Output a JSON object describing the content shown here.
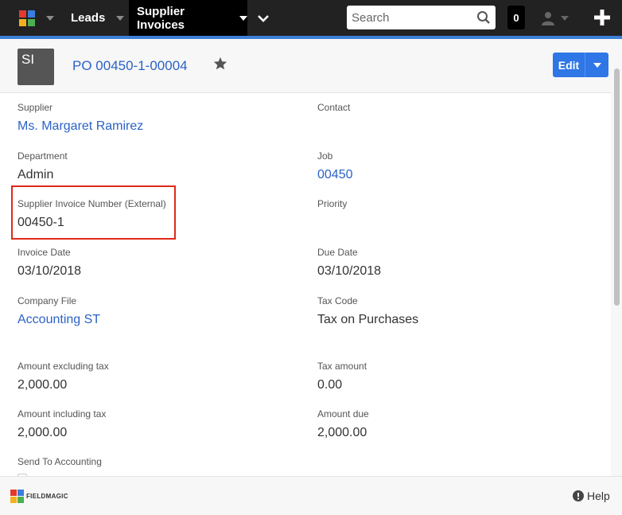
{
  "nav": {
    "leads_label": "Leads",
    "active_label": "Supplier Invoices",
    "search_placeholder": "Search",
    "notification_count": "0"
  },
  "record": {
    "avatar_initials": "SI",
    "title": "PO 00450-1-00004",
    "edit_label": "Edit"
  },
  "fields": {
    "supplier_label": "Supplier",
    "supplier_value": "Ms. Margaret Ramirez",
    "contact_label": "Contact",
    "department_label": "Department",
    "department_value": "Admin",
    "job_label": "Job",
    "job_value": "00450",
    "invoice_number_label": "Supplier Invoice Number (External)",
    "invoice_number_value": "00450-1",
    "priority_label": "Priority",
    "invoice_date_label": "Invoice Date",
    "invoice_date_value": "03/10/2018",
    "due_date_label": "Due Date",
    "due_date_value": "03/10/2018",
    "company_file_label": "Company File",
    "company_file_value": "Accounting ST",
    "tax_code_label": "Tax Code",
    "tax_code_value": "Tax on Purchases",
    "amount_ex_label": "Amount excluding tax",
    "amount_ex_value": "2,000.00",
    "tax_amount_label": "Tax amount",
    "tax_amount_value": "0.00",
    "amount_inc_label": "Amount including tax",
    "amount_inc_value": "2,000.00",
    "amount_due_label": "Amount due",
    "amount_due_value": "2,000.00",
    "send_label": "Send To Accounting"
  },
  "footer": {
    "brand": "FIELDMAGIC",
    "help_label": "Help"
  },
  "colors": {
    "navbar": "#222222",
    "accent": "#3d7fd6",
    "link": "#2b62c7",
    "edit_button": "#2f76e6",
    "highlight": "#e02a18"
  },
  "icons": [
    "app-logo-icon",
    "chevron-down-icon",
    "search-icon",
    "user-icon",
    "plus-icon",
    "star-icon",
    "help-icon"
  ]
}
